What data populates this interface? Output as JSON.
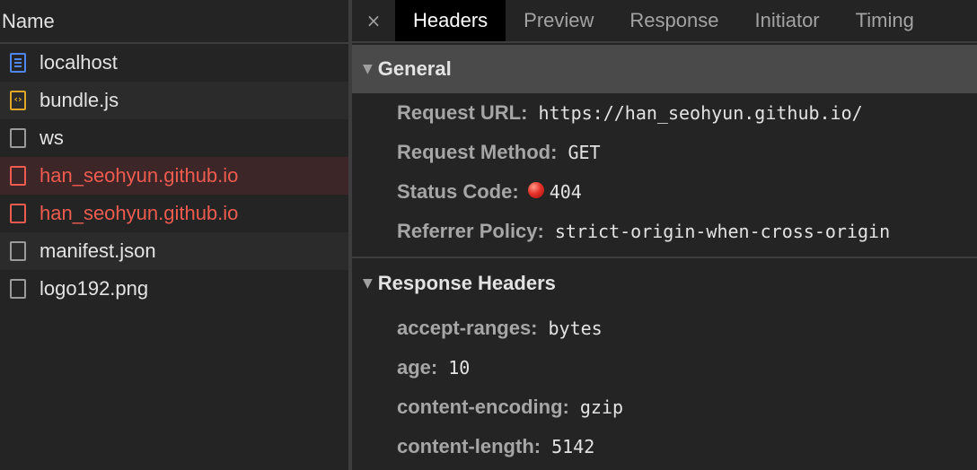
{
  "requests": {
    "header": "Name",
    "items": [
      {
        "label": "localhost"
      },
      {
        "label": "bundle.js"
      },
      {
        "label": "ws"
      },
      {
        "label": "han_seohyun.github.io"
      },
      {
        "label": "han_seohyun.github.io"
      },
      {
        "label": "manifest.json"
      },
      {
        "label": "logo192.png"
      }
    ]
  },
  "tabs": {
    "close": "×",
    "items": [
      "Headers",
      "Preview",
      "Response",
      "Initiator",
      "Timing"
    ],
    "active": "Headers"
  },
  "general": {
    "title": "General",
    "request_url_key": "Request URL:",
    "request_url": "https://han_seohyun.github.io/",
    "method_key": "Request Method:",
    "method": "GET",
    "status_key": "Status Code:",
    "status": "404",
    "referrer_key": "Referrer Policy:",
    "referrer": "strict-origin-when-cross-origin"
  },
  "response_headers": {
    "title": "Response Headers",
    "items": [
      {
        "key": "accept-ranges:",
        "value": "bytes"
      },
      {
        "key": "age:",
        "value": "10"
      },
      {
        "key": "content-encoding:",
        "value": "gzip"
      },
      {
        "key": "content-length:",
        "value": "5142"
      }
    ]
  },
  "colors": {
    "error": "#ee5b4f",
    "doc_icon": "#4f86f0",
    "script_icon": "#e1a628"
  }
}
